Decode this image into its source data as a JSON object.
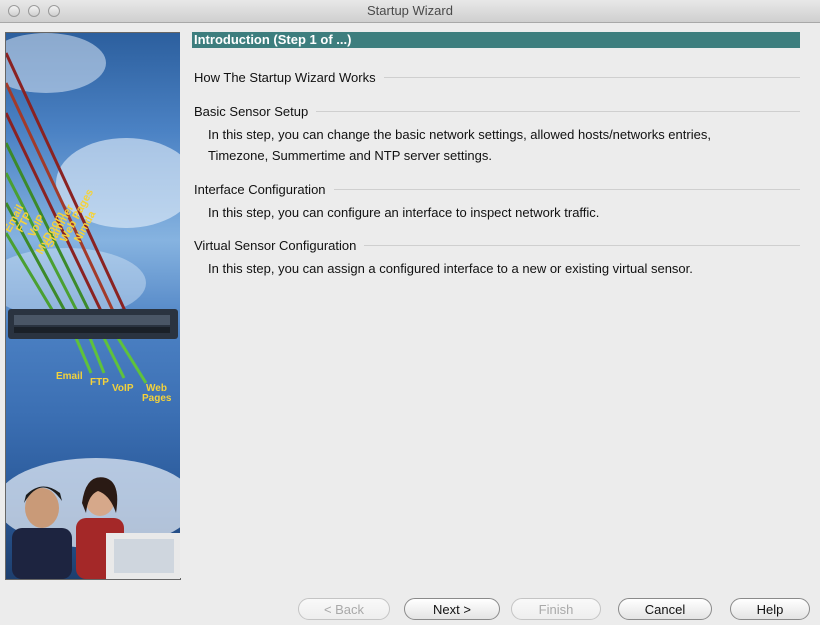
{
  "window": {
    "title": "Startup Wizard"
  },
  "banner": {
    "traffic_labels": [
      "Email",
      "FTP",
      "VoIP",
      "Web Pages",
      "Nimda",
      "Slammer",
      "MyDoom"
    ],
    "output_labels": {
      "email": "Email",
      "ftp": "FTP",
      "voip": "VoIP",
      "web": "Web",
      "pages": "Pages"
    }
  },
  "header": {
    "step_title": "Introduction (Step 1 of ...)"
  },
  "sections": [
    {
      "title": "How The Startup Wizard Works",
      "body": []
    },
    {
      "title": "Basic Sensor Setup",
      "body": [
        "In this step, you can change the basic network settings, allowed hosts/networks entries,",
        "Timezone, Summertime and NTP server settings."
      ]
    },
    {
      "title": "Interface Configuration",
      "body": [
        "In this step, you can configure an interface to inspect network traffic."
      ]
    },
    {
      "title": "Virtual Sensor Configuration",
      "body": [
        "In this step, you can assign a configured interface to a new or existing virtual sensor."
      ]
    }
  ],
  "buttons": {
    "back": "< Back",
    "next": "Next >",
    "finish": "Finish",
    "cancel": "Cancel",
    "help": "Help"
  },
  "colors": {
    "header_bar": "#3d7e7e",
    "sky": "#4b82c4"
  }
}
